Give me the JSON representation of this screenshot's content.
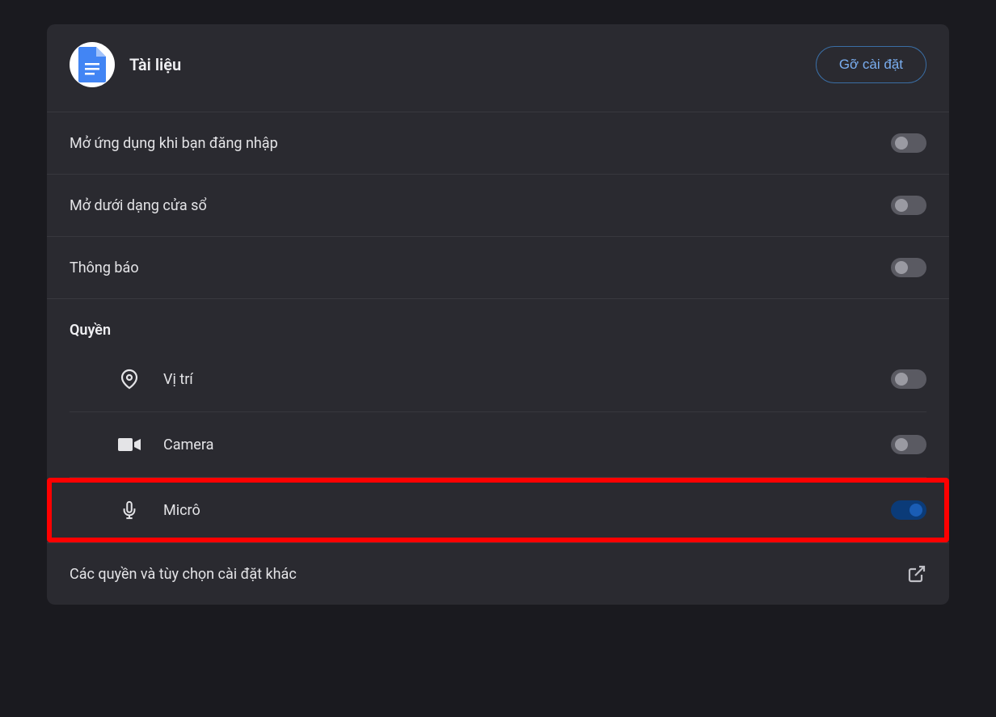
{
  "header": {
    "title": "Tài liệu",
    "uninstall": "Gỡ cài đặt"
  },
  "settings": {
    "open_on_login": "Mở ứng dụng khi bạn đăng nhập",
    "open_as_window": "Mở dưới dạng cửa sổ",
    "notifications": "Thông báo"
  },
  "permissions": {
    "title": "Quyền",
    "items": [
      {
        "label": "Vị trí"
      },
      {
        "label": "Camera"
      },
      {
        "label": "Micrô"
      }
    ]
  },
  "more": {
    "label": "Các quyền và tùy chọn cài đặt khác"
  }
}
